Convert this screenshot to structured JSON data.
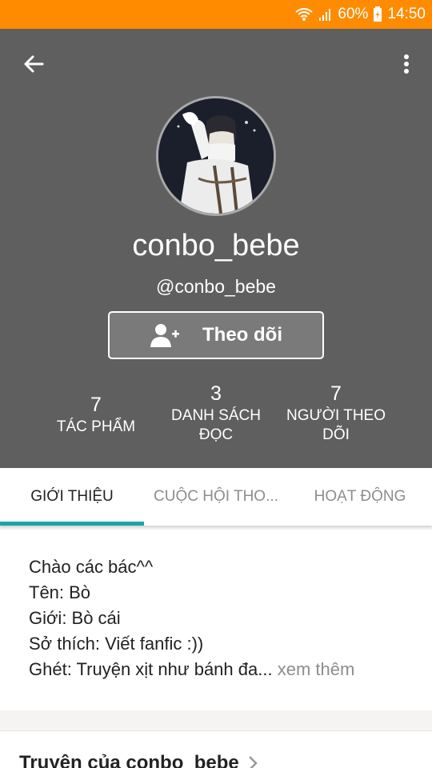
{
  "status_bar": {
    "battery": "60%",
    "time": "14:50",
    "color": "#ff8c00"
  },
  "header": {
    "background": "#5f5f5f",
    "back_icon": "arrow-left-icon",
    "more_icon": "more-vertical-icon",
    "username": "conbo_bebe",
    "handle": "@conbo_bebe",
    "follow_label": "Theo dõi",
    "follow_icon": "add-person-icon"
  },
  "stats": [
    {
      "value": "7",
      "label_line1": "TÁC PHẨM",
      "label_line2": ""
    },
    {
      "value": "3",
      "label_line1": "DANH SÁCH",
      "label_line2": "ĐỌC"
    },
    {
      "value": "7",
      "label_line1": "NGƯỜI THEO",
      "label_line2": "DÕI"
    }
  ],
  "tabs": [
    {
      "label": "GIỚI THIỆU",
      "active": true
    },
    {
      "label": "CUỘC HỘI THO...",
      "active": false
    },
    {
      "label": "HOẠT ĐỘNG",
      "active": false
    }
  ],
  "tab_accent": "#1aa5a5",
  "about": {
    "lines": [
      "Chào các bác^^",
      "Tên: Bò",
      "Giới: Bò cái",
      "Sở thích: Viết fanfic :))",
      "Ghét: Truyện xịt như bánh đa..."
    ],
    "see_more": "xem thêm"
  },
  "works_section": {
    "title": "Truyện của conbo_bebe",
    "chevron_icon": "chevron-right-icon"
  }
}
